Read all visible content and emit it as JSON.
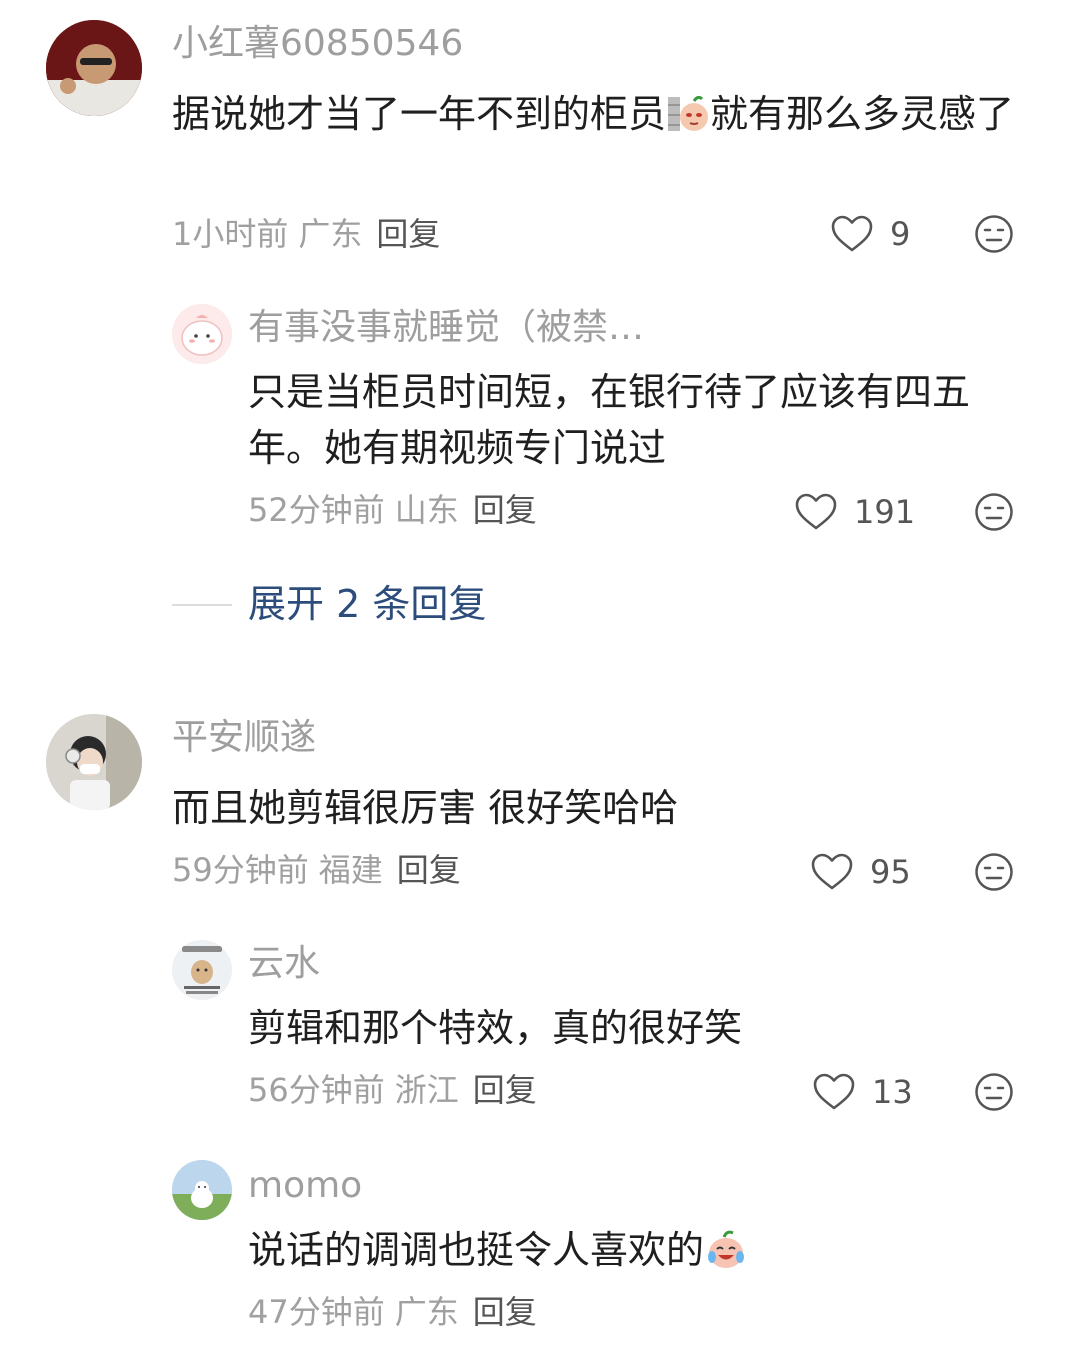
{
  "comments": [
    {
      "user": "小红薯60850546",
      "text_before": "据说她才当了一年不到的柜员",
      "text_after": "就有那么多灵感了",
      "time": "1小时前",
      "location": "广东",
      "reply_label": "回复",
      "likes": "9"
    },
    {
      "user": "有事没事就睡觉（被禁…",
      "text": "只是当柜员时间短，在银行待了应该有四五年。她有期视频专门说过",
      "time": "52分钟前",
      "location": "山东",
      "reply_label": "回复",
      "likes": "191"
    },
    {
      "user": "平安顺遂",
      "text": "而且她剪辑很厉害 很好笑哈哈",
      "time": "59分钟前",
      "location": "福建",
      "reply_label": "回复",
      "likes": "95"
    },
    {
      "user": "云水",
      "text": "剪辑和那个特效，真的很好笑",
      "time": "56分钟前",
      "location": "浙江",
      "reply_label": "回复",
      "likes": "13"
    },
    {
      "user": "momo",
      "text": "说话的调调也挺令人喜欢的",
      "time": "47分钟前",
      "location": "广东",
      "reply_label": "回复"
    }
  ],
  "expand_replies": "展开 2 条回复",
  "icons": {
    "like": "heart-outline-icon",
    "dislike": "meh-face-icon",
    "emoji_1": "peek-wall-emoji",
    "emoji_2": "laugh-cry-emoji"
  },
  "colors": {
    "username": "#9e9e9e",
    "text": "#1f1f1f",
    "meta": "#a0a0a0",
    "link": "#2c4d7c"
  }
}
